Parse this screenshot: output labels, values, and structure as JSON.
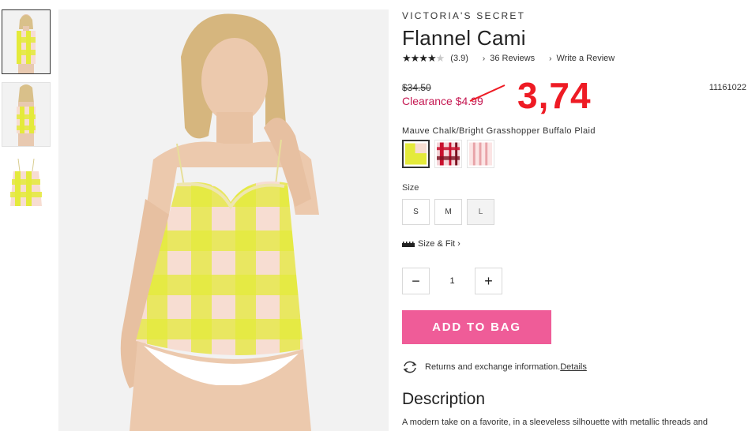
{
  "product": {
    "brand": "VICTORIA'S SECRET",
    "title": "Flannel Cami",
    "stars": "★★★★",
    "stars_off": "★",
    "rating_text": "(3.9)",
    "reviews_link": "36 Reviews",
    "write_review_link": "Write a Review",
    "old_price": "$34.50",
    "clearance_price": "Clearance $4.99",
    "sku": "11161022",
    "annotation": "3,74",
    "color_name": "Mauve Chalk/Bright Grasshopper Buffalo Plaid",
    "size_label": "Size",
    "sizes": [
      "S",
      "M",
      "L"
    ],
    "size_fit_link": "Size & Fit",
    "quantity": "1",
    "add_to_bag": "ADD TO BAG",
    "returns_text": "Returns and exchange information.",
    "returns_link": "Details",
    "description_title": "Description",
    "description_text": "A modern take on a favorite, in a sleeveless silhouette with metallic threads and"
  },
  "colors": {
    "accent_pink": "#ef5c98",
    "clearance_red": "#c51852",
    "annotation_red": "#ee1b24",
    "plaid_yellow": "#e4ea3b",
    "plaid_pink": "#f7ddd2"
  },
  "icons": {
    "minus": "−",
    "plus": "+",
    "chevron": "›"
  }
}
